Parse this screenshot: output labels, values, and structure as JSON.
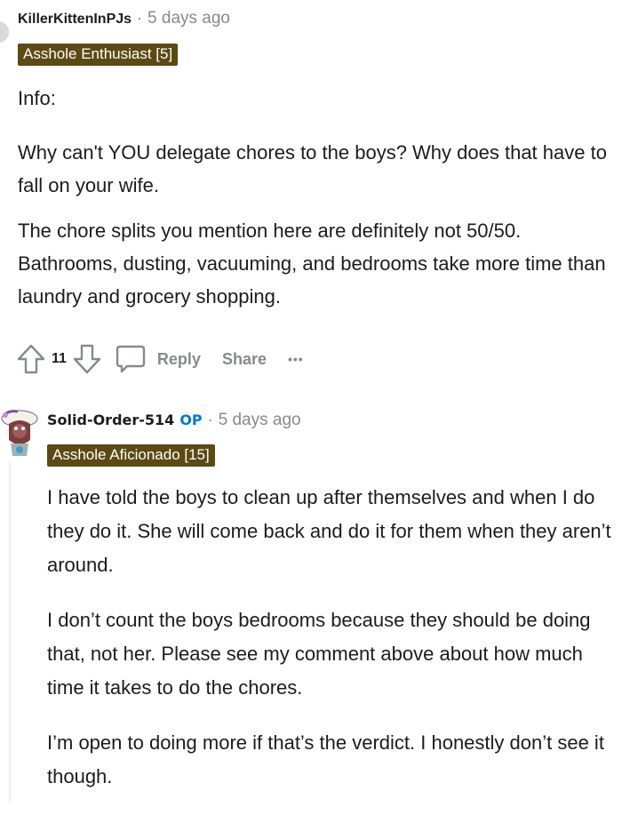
{
  "comment1": {
    "username": "KillerKittenInPJs",
    "separator": "·",
    "time": "5 days ago",
    "flair": "Asshole Enthusiast [5]",
    "paragraphs": [
      "Info:",
      "Why can't YOU delegate chores to the boys? Why does that have to fall on your wife.",
      "The chore splits you mention here are definitely not 50/50. Bathrooms, dusting, vacuuming, and bedrooms take more time than laundry and grocery shopping."
    ],
    "actions": {
      "upvote_icon": "arrow-up-icon",
      "votes": "11",
      "downvote_icon": "arrow-down-icon",
      "comment_icon": "speech-bubble-icon",
      "reply": "Reply",
      "share": "Share",
      "more": "•••"
    }
  },
  "comment2": {
    "username": "Solid-Order-514",
    "op_badge": "OP",
    "separator": "·",
    "time": "5 days ago",
    "flair": "Asshole Aficionado [15]",
    "paragraphs": [
      "I have told the boys to clean up after themselves and when I do they do it. She will come back and do it for them when they aren’t around.",
      "I don’t count the boys bedrooms because they should be doing that, not her. Please see my comment above about how much time it takes to do the chores.",
      "I’m open to doing more if that’s the verdict. I honestly don’t see it though."
    ]
  },
  "colors": {
    "flair_bg": "#5c4a14",
    "op_blue": "#0079d3",
    "meta_gray": "#878a8c"
  }
}
